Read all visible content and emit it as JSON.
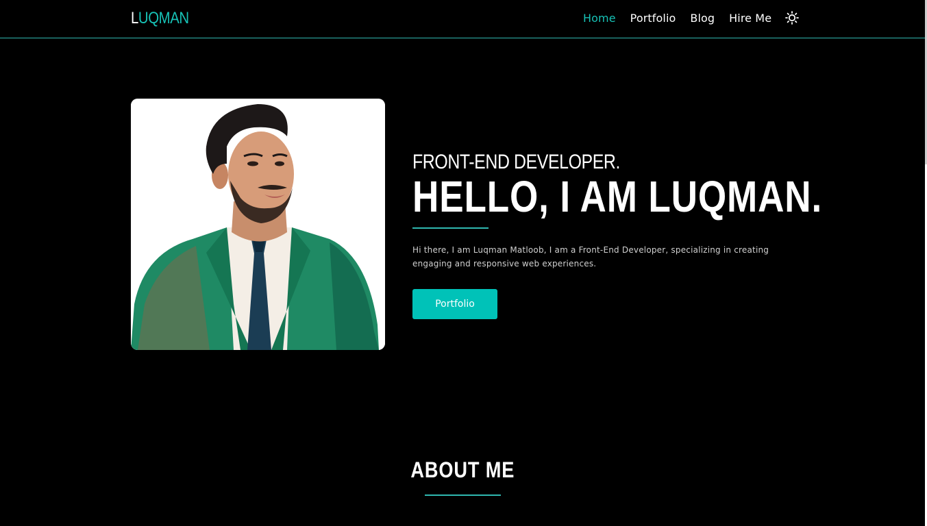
{
  "header": {
    "logo_first": "L",
    "logo_rest": "UQMAN",
    "nav": [
      {
        "label": "Home",
        "active": true
      },
      {
        "label": "Portfolio",
        "active": false
      },
      {
        "label": "Blog",
        "active": false
      },
      {
        "label": "Hire Me",
        "active": false
      }
    ],
    "theme_icon": "sun-icon"
  },
  "hero": {
    "subtitle": "FRONT-END DEVELOPER.",
    "title": "HELLO, I AM LUQMAN.",
    "intro": "Hi there, I am Luqman Matloob, I am a Front-End Developer, specializing in creating engaging and responsive web experiences.",
    "cta_label": "Portfolio"
  },
  "about": {
    "title": "ABOUT ME"
  },
  "colors": {
    "accent": "#17c2b6",
    "button": "#00c2b8",
    "background": "#000000"
  }
}
